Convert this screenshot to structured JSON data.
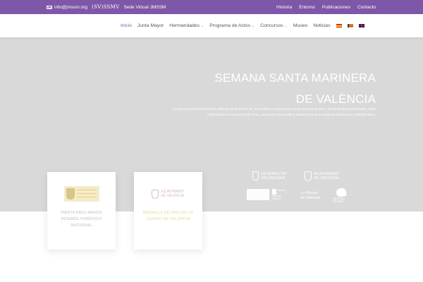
{
  "topbar": {
    "email": "info@jmssm.org",
    "ssmv_logo": "(SV)SSMV",
    "virtual_link": "Sede Virtual JMSSM",
    "links": [
      "Historia",
      "Entorno",
      "Publicaciones",
      "Contacto"
    ],
    "bg_color": "#7e57a8"
  },
  "nav": {
    "items": [
      {
        "label": "Inicio",
        "active": true,
        "dropdown": false
      },
      {
        "label": "Junta Mayor",
        "active": false,
        "dropdown": false
      },
      {
        "label": "Hermandades",
        "active": false,
        "dropdown": true
      },
      {
        "label": "Programa de Actos",
        "active": false,
        "dropdown": true
      },
      {
        "label": "Concursos",
        "active": false,
        "dropdown": true
      },
      {
        "label": "Museo",
        "active": false,
        "dropdown": false
      },
      {
        "label": "Noticias",
        "active": false,
        "dropdown": false
      }
    ],
    "flags": [
      "es-flag-icon",
      "va-flag-icon",
      "en-flag-icon"
    ],
    "accent_color": "#7e57a8"
  },
  "hero": {
    "title_line1": "SEMANA SANTA MARINERA",
    "title_line2": "DE VALÈNCIA",
    "description": "La Semana Santa Marinera de València nació de la fe de los hombres y mujeres que vivían cerca de la mar y, desde tiempo inmemoriales, viene celebrándose en los barrios del Grau, Cabanyal-Canyamelar y Natzaret donde la ciudad se abraza con el Mediterráneo.",
    "bg_color": "#d9d9d9",
    "logos": {
      "generalitat": [
        "GENERALITAT",
        "VALENCIANA"
      ],
      "ajuntament": [
        "AJUNTAMENT",
        "DE VALÈNCIA"
      ],
      "marina": [
        "La Marina",
        "de València"
      ],
      "small_caption": [
        "Marina",
        "València",
        "Turismo"
      ],
      "heart_caption": [
        "FIESTA DE",
        "INTERÉS"
      ]
    }
  },
  "cards": [
    {
      "label": "FIESTA DECLARADA INTERÉS TURÍSTICO NACIONAL",
      "logo": "spain-government-emblem-icon"
    },
    {
      "label": "MEDALLA DE ORO DE LA CIUDAD DE VALÈNCIA",
      "logo": "ajuntament-valencia-crest-icon",
      "logo_text": [
        "AJUNTAMENT",
        "DE VALÈNCIA"
      ]
    }
  ]
}
